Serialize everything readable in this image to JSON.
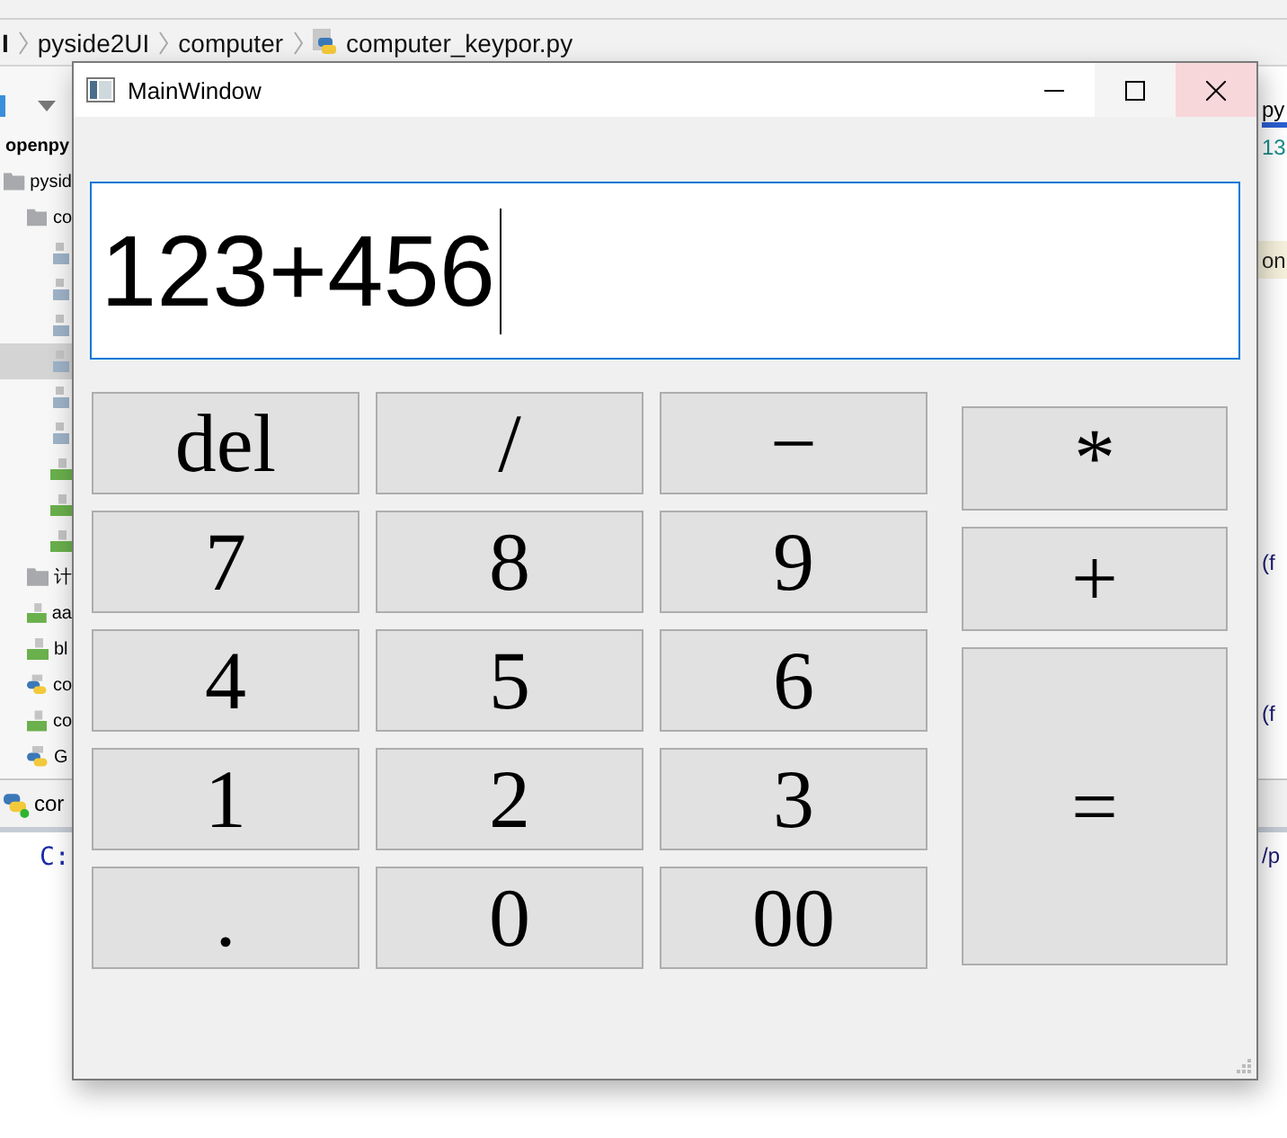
{
  "ide": {
    "breadcrumbs": [
      "I",
      "pyside2UI",
      "computer",
      "computer_keypor.py"
    ],
    "tree": [
      {
        "label": "openpy",
        "kind": "project",
        "selected": false,
        "children": [
          {
            "label": "pysid",
            "kind": "folder",
            "selected": false,
            "children": [
              {
                "label": "co",
                "kind": "folder",
                "selected": false,
                "children": [
                  {
                    "kind": "file",
                    "selected": false
                  },
                  {
                    "kind": "file",
                    "selected": false
                  },
                  {
                    "kind": "file",
                    "selected": false
                  },
                  {
                    "kind": "file",
                    "selected": true
                  },
                  {
                    "kind": "file",
                    "selected": false
                  },
                  {
                    "kind": "file",
                    "selected": false
                  },
                  {
                    "kind": "qt",
                    "selected": false
                  },
                  {
                    "kind": "qt",
                    "selected": false
                  },
                  {
                    "kind": "qt",
                    "selected": false
                  }
                ]
              },
              {
                "label": "计",
                "kind": "folder",
                "selected": false
              },
              {
                "label": "aa",
                "kind": "qt",
                "selected": false
              },
              {
                "label": "bl",
                "kind": "qt",
                "selected": false
              },
              {
                "label": "co",
                "kind": "python",
                "selected": false
              },
              {
                "label": "co",
                "kind": "qt",
                "selected": false
              },
              {
                "label": "G",
                "kind": "python",
                "selected": false
              }
            ]
          }
        ]
      }
    ],
    "editor": {
      "tab_label": "py",
      "lines": [
        {
          "text": "13",
          "highlighted": false
        },
        {
          "text": "on",
          "highlighted": true
        },
        {
          "text": "(f",
          "highlighted": false
        },
        {
          "text": "(f",
          "highlighted": false
        }
      ]
    },
    "run": {
      "tab_label": "cor",
      "console_left": "C:",
      "console_right": "/p"
    }
  },
  "window": {
    "title": "MainWindow"
  },
  "display": {
    "value": "123+456",
    "focused": true
  },
  "keypad": [
    {
      "label": "del"
    },
    {
      "label": "/"
    },
    {
      "label": "−"
    },
    {
      "label": "7"
    },
    {
      "label": "8"
    },
    {
      "label": "9"
    },
    {
      "label": "4"
    },
    {
      "label": "5"
    },
    {
      "label": "6"
    },
    {
      "label": "1"
    },
    {
      "label": "2"
    },
    {
      "label": "3"
    },
    {
      "label": "."
    },
    {
      "label": "0"
    },
    {
      "label": "00"
    }
  ],
  "side_keys": [
    {
      "label": "*"
    },
    {
      "label": "+"
    },
    {
      "label": "="
    }
  ]
}
